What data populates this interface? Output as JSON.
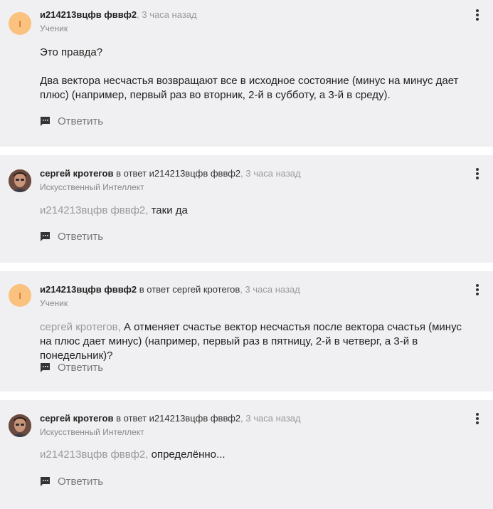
{
  "reply_label": "Ответить",
  "comments": [
    {
      "avatar_letter": "I",
      "author": "и214213вцфв фввф2",
      "reply_prefix": "",
      "reply_to": "",
      "time": ", 3 часа назад",
      "role": "Ученик",
      "para1": "Это правда?",
      "para2": "Два вектора несчастья возвращают все в исходное состояние (минус на минус дает плюс) (например, первый раз во вторник, 2-й в субботу, а 3-й в среду)."
    },
    {
      "author": "сергей кротегов",
      "reply_prefix": " в ответ ",
      "reply_to": "и214213вцфв фввф2",
      "time": ", 3 часа назад",
      "role": "Искусственный Интеллект",
      "mention": "и214213вцфв фввф2,",
      "body": " таки да"
    },
    {
      "avatar_letter": "I",
      "author": "и214213вцфв фввф2",
      "reply_prefix": " в ответ ",
      "reply_to": "сергей кротегов",
      "time": ", 3 часа назад",
      "role": "Ученик",
      "mention": "сергей кротегов,",
      "body": " А отменяет счастье вектор несчастья после вектора счастья (минус на плюс дает минус) (например, первый раз в пятницу, 2-й в четверг, а 3-й в понедельник)?"
    },
    {
      "author": "сергей кротегов",
      "reply_prefix": " в ответ ",
      "reply_to": "и214213вцфв фввф2",
      "time": ", 3 часа назад",
      "role": "Искусственный Интеллект",
      "mention": "и214213вцфв фввф2,",
      "body": " определённо..."
    }
  ]
}
